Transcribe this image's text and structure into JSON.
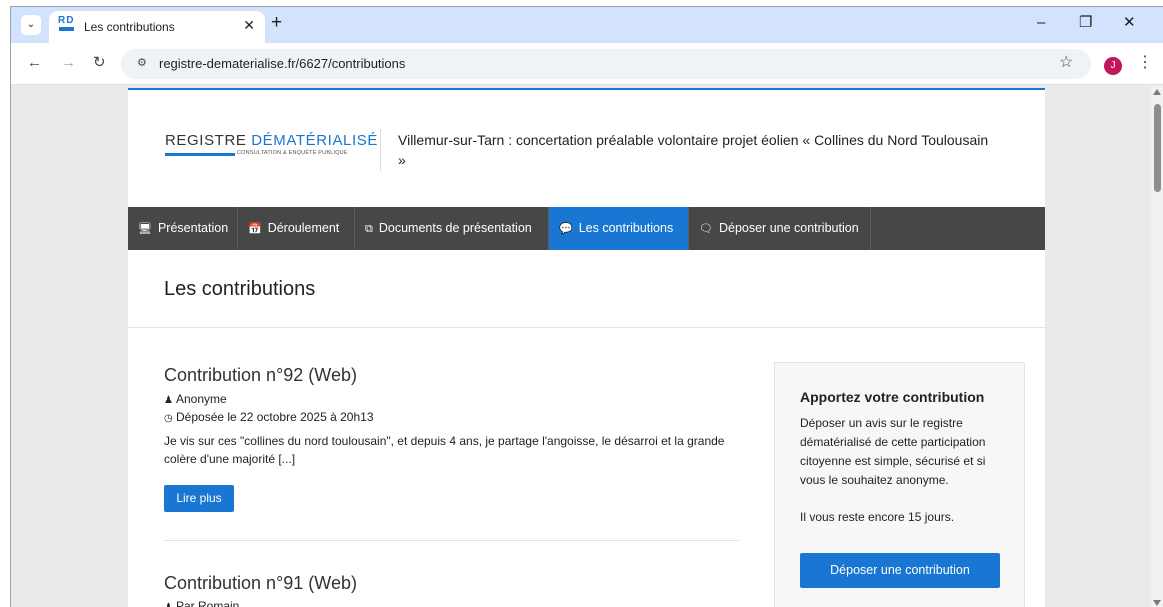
{
  "browser": {
    "tab_title": "Les contributions",
    "favicon_text": "RD",
    "url": "registre-dematerialise.fr/6627/contributions",
    "avatar_initial": "J"
  },
  "site": {
    "logo_main": "REGISTRE ",
    "logo_accent": "DÉMATÉRIALISÉ",
    "logo_sub": "CONSULTATION & ENQUÊTE PUBLIQUE",
    "consultation_title": "Villemur-sur-Tarn : concertation préalable volontaire projet éolien « Collines du Nord Toulousain »"
  },
  "nav": {
    "items": [
      {
        "label": "Présentation",
        "icon": "monitor-icon"
      },
      {
        "label": "Déroulement",
        "icon": "calendar-icon"
      },
      {
        "label": "Documents de présentation",
        "icon": "documents-icon"
      },
      {
        "label": "Les contributions",
        "icon": "comments-icon",
        "active": true
      },
      {
        "label": "Déposer une contribution",
        "icon": "comment-icon"
      }
    ]
  },
  "main": {
    "section_title": "Les contributions",
    "contributions": [
      {
        "title": "Contribution n°92 (Web)",
        "author": "Anonyme",
        "date": "Déposée le 22 octobre 2025 à 20h13",
        "excerpt": "Je vis sur ces \"collines du nord toulousain\", et depuis 4 ans, je partage l'angoisse, le désarroi et la grande colère d'une majorité [...]",
        "read_more": "Lire plus"
      },
      {
        "title": "Contribution n°91 (Web)",
        "author": "Par Romain"
      }
    ]
  },
  "sidebar": {
    "title": "Apportez votre contribution",
    "text": "Déposer un avis sur le registre dématérialisé de cette participation citoyenne est simple, sécurisé et si vous le souhaitez anonyme.",
    "remaining": "Il vous reste encore 15 jours.",
    "button": "Déposer une contribution"
  }
}
